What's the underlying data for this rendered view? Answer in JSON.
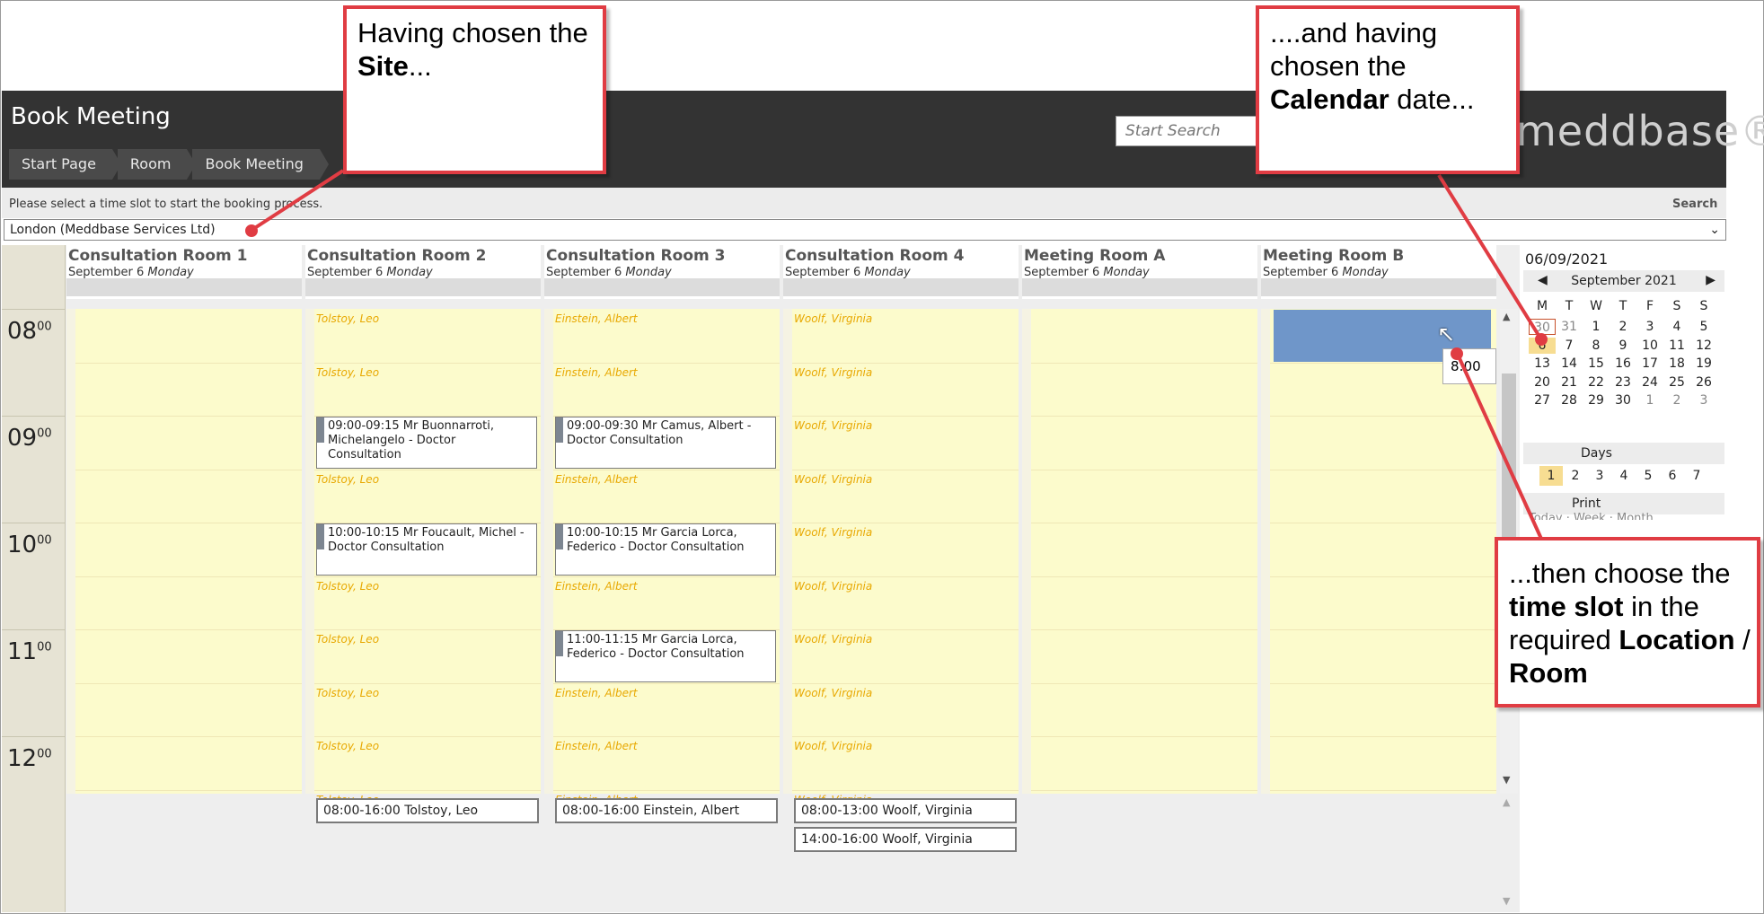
{
  "app": {
    "title": "Book Meeting",
    "logo": "meddbase®",
    "search_placeholder": "Start Search"
  },
  "breadcrumbs": [
    "Start Page",
    "Room",
    "Book Meeting"
  ],
  "subbar": {
    "prompt": "Please select a time slot to start the booking process.",
    "search_link": "Search"
  },
  "site_select": {
    "value": "London (Meddbase Services Ltd)",
    "icon": "chevron-down-icon"
  },
  "hours": [
    "08",
    "09",
    "10",
    "11",
    "12"
  ],
  "hour_suffix": "00",
  "rooms": [
    {
      "name": "Consultation Room 1",
      "date": "September 6",
      "day": "Monday",
      "clinician": "",
      "appointments": [],
      "rotas": []
    },
    {
      "name": "Consultation Room 2",
      "date": "September 6",
      "day": "Monday",
      "clinician": "Tolstoy, Leo",
      "appointments": [
        {
          "text": "09:00-09:15 Mr Buonnarroti, Michelangelo - Doctor Consultation"
        },
        {
          "text": "10:00-10:15 Mr Foucault, Michel - Doctor Consultation"
        }
      ],
      "rotas": [
        "08:00-16:00 Tolstoy, Leo"
      ]
    },
    {
      "name": "Consultation Room 3",
      "date": "September 6",
      "day": "Monday",
      "clinician": "Einstein, Albert",
      "appointments": [
        {
          "text": "09:00-09:30 Mr Camus, Albert - Doctor Consultation"
        },
        {
          "text": "10:00-10:15 Mr Garcia Lorca, Federico - Doctor Consultation"
        },
        {
          "text": "11:00-11:15 Mr Garcia Lorca, Federico - Doctor Consultation"
        }
      ],
      "rotas": [
        "08:00-16:00 Einstein, Albert"
      ]
    },
    {
      "name": "Consultation Room 4",
      "date": "September 6",
      "day": "Monday",
      "clinician": "Woolf, Virginia",
      "appointments": [],
      "rotas": [
        "08:00-13:00 Woolf, Virginia",
        "14:00-16:00 Woolf, Virginia"
      ]
    },
    {
      "name": "Meeting Room A",
      "date": "September 6",
      "day": "Monday",
      "clinician": "",
      "appointments": [],
      "rotas": []
    },
    {
      "name": "Meeting Room B",
      "date": "September 6",
      "day": "Monday",
      "clinician": "",
      "appointments": [],
      "rotas": [],
      "selected_slot_tooltip": "8:00"
    }
  ],
  "sidebar": {
    "selected_date": "06/09/2021",
    "month_label": "September 2021",
    "prev_icon": "caret-left-icon",
    "next_icon": "caret-right-icon",
    "dow": [
      "M",
      "T",
      "W",
      "T",
      "F",
      "S",
      "S"
    ],
    "weeks": [
      [
        "30",
        "31",
        "1",
        "2",
        "3",
        "4",
        "5"
      ],
      [
        "6",
        "7",
        "8",
        "9",
        "10",
        "11",
        "12"
      ],
      [
        "13",
        "14",
        "15",
        "16",
        "17",
        "18",
        "19"
      ],
      [
        "20",
        "21",
        "22",
        "23",
        "24",
        "25",
        "26"
      ],
      [
        "27",
        "28",
        "29",
        "30",
        "1",
        "2",
        "3"
      ]
    ],
    "days_label": "Days",
    "days": [
      "1",
      "2",
      "3",
      "4",
      "5",
      "6",
      "7"
    ],
    "print_label": "Print",
    "print_links_partial": "Today · Week · Month"
  },
  "callouts": {
    "site": {
      "pre": "Having chosen the ",
      "bold": "Site",
      "post": "..."
    },
    "calendar": {
      "pre": "....and having chosen the ",
      "bold": "Calendar",
      "post": " date..."
    },
    "timeslot": {
      "pre": "...then choose the ",
      "bold1": "time slot",
      "mid": " in the required ",
      "bold2": "Location",
      "mid2": " / ",
      "bold3": "Room"
    }
  },
  "colors": {
    "header": "#333333",
    "slot": "#fcfbcc",
    "selected": "#6f96c9",
    "callout_border": "#e03c43",
    "clinician_text": "#e8a800"
  }
}
